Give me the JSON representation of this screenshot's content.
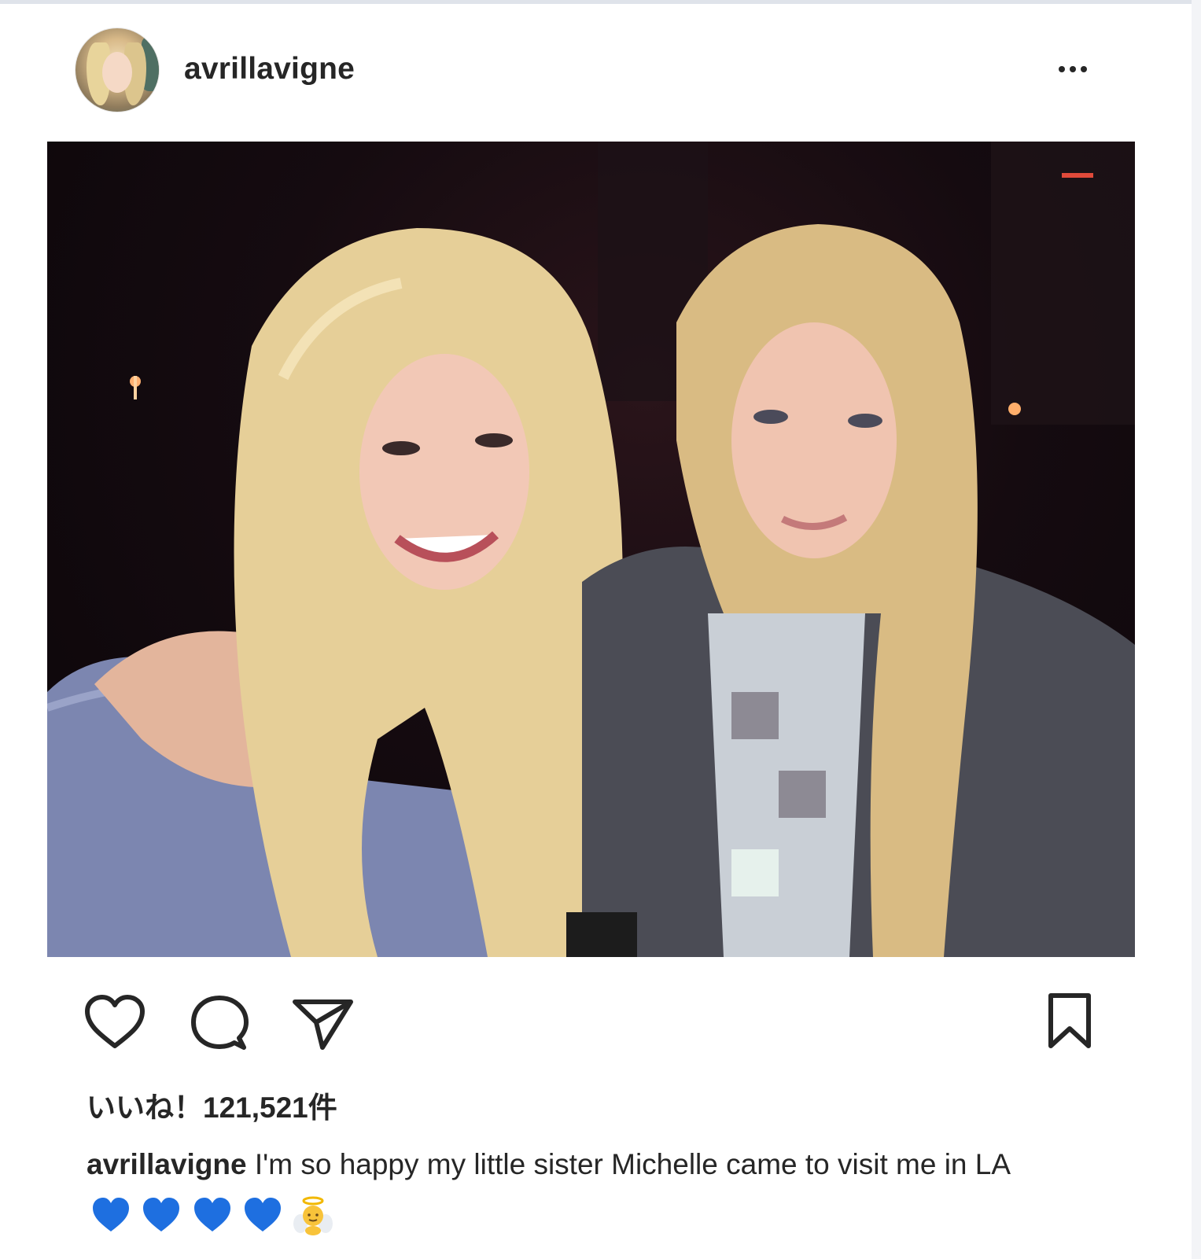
{
  "post": {
    "username": "avrillavigne",
    "more_label": "more-options",
    "likes_text": "いいね！121,521件",
    "caption_user": "avrillavigne",
    "caption_text": "I'm so happy my little sister Michelle came to visit me in LA",
    "caption_emojis": [
      "blue-heart",
      "blue-heart",
      "blue-heart",
      "blue-heart",
      "baby-angel"
    ]
  },
  "icons": {
    "more": "ellipsis-icon",
    "like": "heart-outline-icon",
    "comment": "speech-bubble-icon",
    "share": "paper-plane-icon",
    "save": "bookmark-icon"
  },
  "colors": {
    "text": "#262626",
    "emoji_heart": "#1e6fe0",
    "photo_background": "#120a0e"
  }
}
